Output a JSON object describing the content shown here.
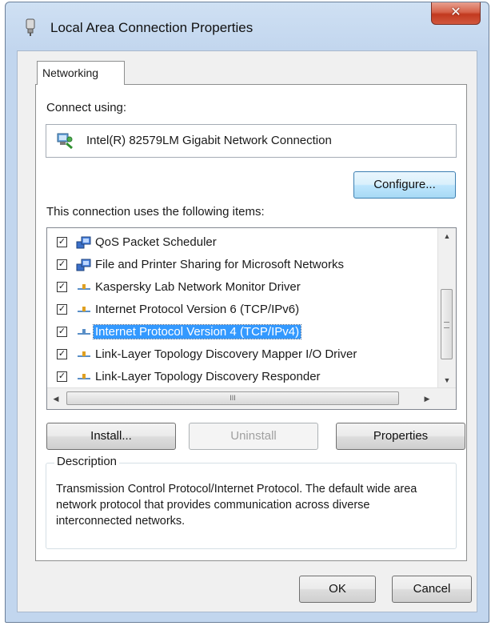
{
  "window": {
    "title": "Local Area Connection Properties",
    "close_symbol": "✕"
  },
  "tabs": [
    {
      "label": "Networking",
      "active": true
    }
  ],
  "connect_using": {
    "label": "Connect using:",
    "adapter_name": "Intel(R) 82579LM Gigabit Network Connection",
    "adapter_icon": "network-adapter-icon"
  },
  "buttons": {
    "configure": "Configure...",
    "install": "Install...",
    "uninstall": "Uninstall",
    "properties": "Properties",
    "ok": "OK",
    "cancel": "Cancel"
  },
  "items_section": {
    "label": "This connection uses the following items:",
    "items": [
      {
        "label": "QoS Packet Scheduler",
        "checked": true,
        "icon": "network-service-icon",
        "selected": false
      },
      {
        "label": "File and Printer Sharing for Microsoft Networks",
        "checked": true,
        "icon": "network-service-icon",
        "selected": false
      },
      {
        "label": "Kaspersky Lab Network Monitor Driver",
        "checked": true,
        "icon": "protocol-icon",
        "selected": false
      },
      {
        "label": "Internet Protocol Version 6 (TCP/IPv6)",
        "checked": true,
        "icon": "protocol-icon",
        "selected": false
      },
      {
        "label": "Internet Protocol Version 4 (TCP/IPv4)",
        "checked": true,
        "icon": "protocol-icon",
        "selected": true
      },
      {
        "label": "Link-Layer Topology Discovery Mapper I/O Driver",
        "checked": true,
        "icon": "protocol-icon",
        "selected": false
      },
      {
        "label": "Link-Layer Topology Discovery Responder",
        "checked": true,
        "icon": "protocol-icon",
        "selected": false
      }
    ],
    "hscroll_grip": "III"
  },
  "description": {
    "title": "Description",
    "text": "Transmission Control Protocol/Internet Protocol. The default wide area network protocol that provides communication across diverse interconnected networks."
  },
  "colors": {
    "selection": "#3399ff",
    "close_button": "#c2391f"
  }
}
